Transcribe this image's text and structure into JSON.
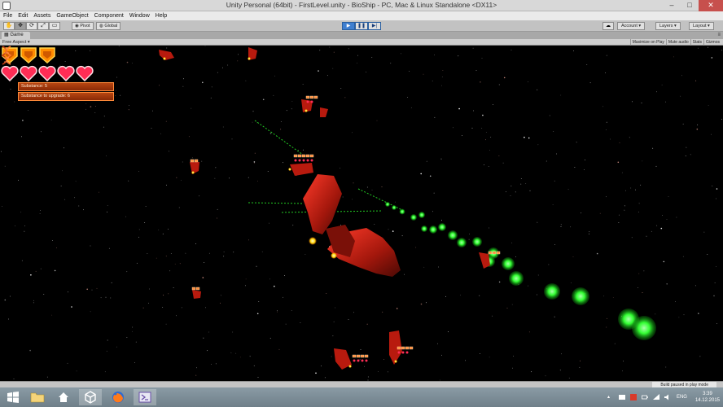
{
  "window": {
    "title": "Unity Personal (64bit) - FirstLevel.unity - BioShip - PC, Mac & Linux Standalone <DX11>",
    "minimize_label": "–",
    "maximize_label": "□",
    "close_label": "✕"
  },
  "menu": [
    "File",
    "Edit",
    "Assets",
    "GameObject",
    "Component",
    "Window",
    "Help"
  ],
  "toolbar": {
    "tools": [
      "hand-icon",
      "move-icon",
      "rotate-icon",
      "scale-icon",
      "rect-icon"
    ],
    "pivot_label": "Pivot",
    "global_label": "Global",
    "play_label": "▶",
    "pause_label": "❚❚",
    "step_label": "▶|",
    "account_label": "Account",
    "layers_label": "Layers",
    "layout_label": "Layout"
  },
  "game_tab": {
    "label": "Game",
    "aspect_label": "Free Aspect",
    "options": [
      "Maximize on Play",
      "Mute audio",
      "Stats",
      "Gizmos"
    ]
  },
  "hud": {
    "shield_count": 3,
    "hearts_count": 5,
    "substance_label": "Substance: 5",
    "upgrade_label": "Substance to upgrade: 6"
  },
  "status": {
    "message": "Build paused in play mode"
  },
  "taskbar": {
    "items": [
      "folder-icon",
      "windows-store-icon",
      "unity-icon",
      "firefox-icon",
      "visual-studio-icon"
    ],
    "language": "ENG",
    "time": "3:39",
    "date": "14.12.2015"
  },
  "colors": {
    "accent": "#3f7fd0",
    "hud_orange": "#b84612",
    "heart_red": "#ff2d55",
    "shield_orange": "#ff8c00",
    "projectile_green": "#33ff33",
    "enemy_red": "#c81e10"
  }
}
